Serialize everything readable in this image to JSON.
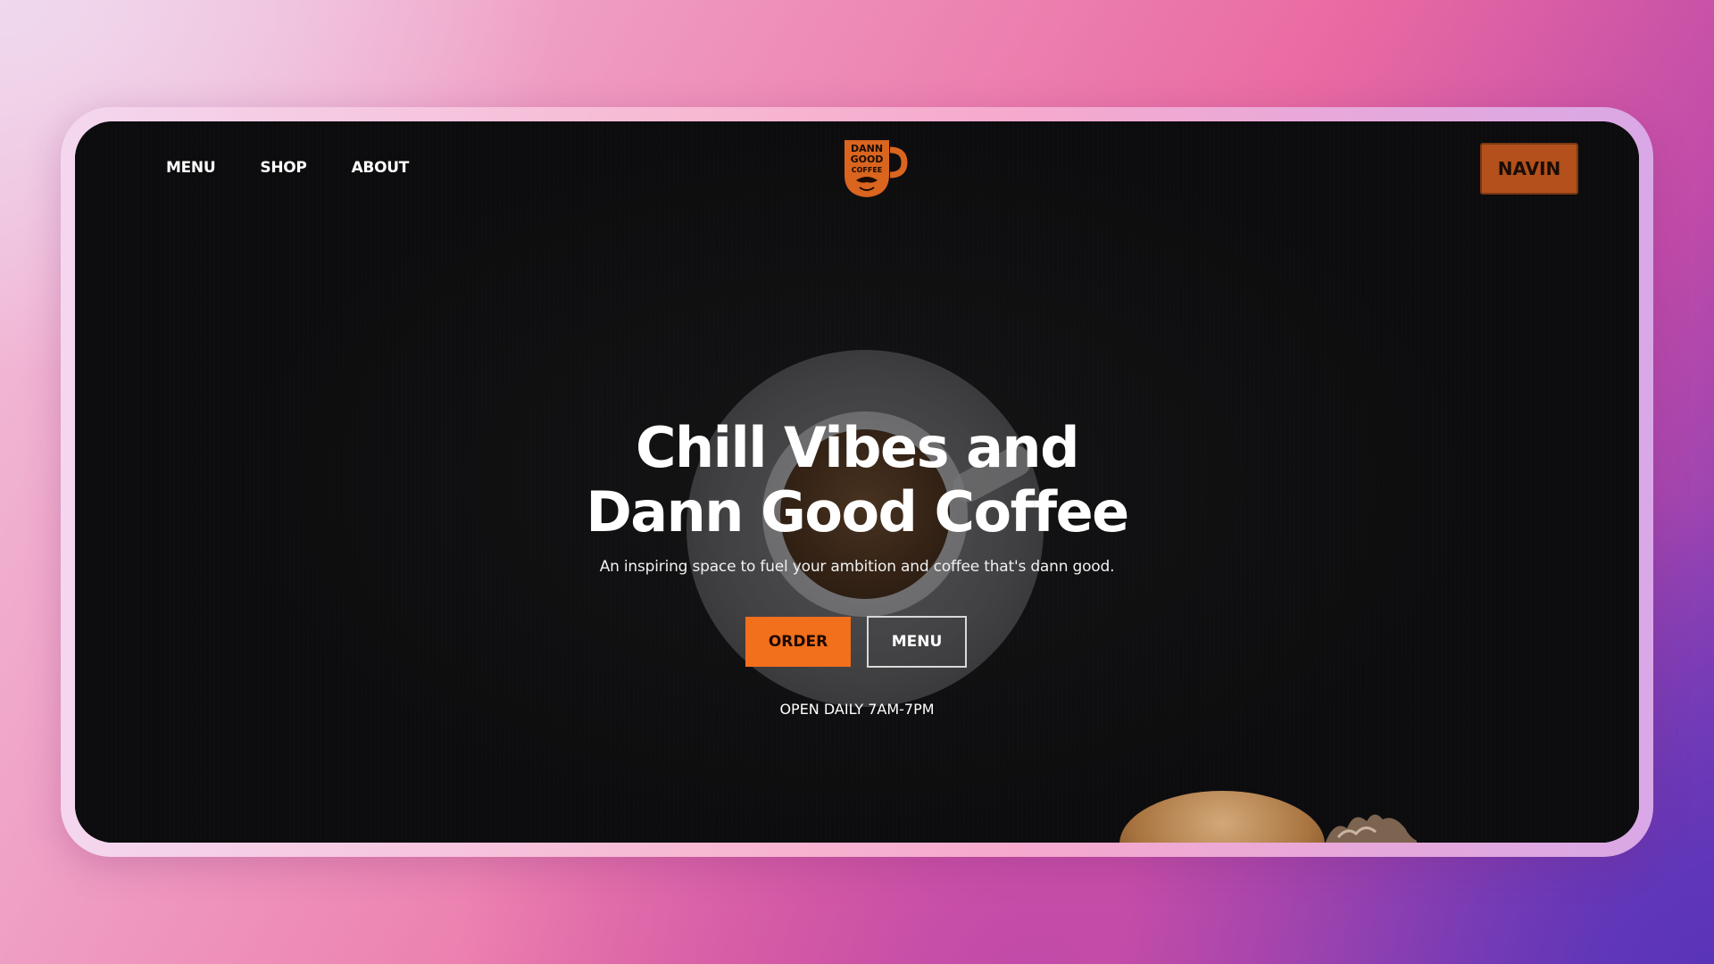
{
  "nav": {
    "items": [
      {
        "label": "MENU"
      },
      {
        "label": "SHOP"
      },
      {
        "label": "ABOUT"
      }
    ]
  },
  "logo": {
    "line1": "DANN",
    "line2": "GOOD",
    "line3": "COFFEE",
    "color": "#d9651f"
  },
  "user": {
    "label": "NAVIN"
  },
  "hero": {
    "title_line1": "Chill Vibes and",
    "title_line2": "Dann Good Coffee",
    "subtitle": "An inspiring space to fuel your ambition and coffee that's dann good.",
    "order_label": "ORDER",
    "menu_label": "MENU",
    "hours": "OPEN DAILY 7AM-7PM"
  },
  "colors": {
    "accent": "#f26f1b",
    "user_button": "#b3501b",
    "background": "#101011"
  }
}
